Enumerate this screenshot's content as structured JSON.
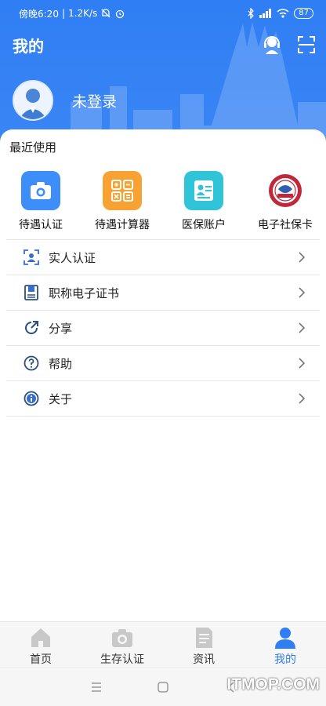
{
  "status_bar": {
    "time": "傍晚6:20",
    "network_speed": "1.2K/s",
    "battery": "87"
  },
  "header": {
    "title": "我的",
    "login_status": "未登录"
  },
  "recent": {
    "title": "最近使用",
    "items": [
      {
        "label": "待遇认证",
        "icon": "camera-icon",
        "color": "#3d8ef8"
      },
      {
        "label": "待遇计算器",
        "icon": "calculator-icon",
        "color": "#f7a233"
      },
      {
        "label": "医保账户",
        "icon": "id-card-icon",
        "color": "#2fc4d8"
      },
      {
        "label": "电子社保卡",
        "icon": "social-security-card-icon",
        "color": "#c0283a"
      }
    ]
  },
  "menu": {
    "items": [
      {
        "label": "实人认证",
        "icon": "face-scan-icon"
      },
      {
        "label": "职称电子证书",
        "icon": "certificate-icon"
      },
      {
        "label": "分享",
        "icon": "share-icon"
      },
      {
        "label": "帮助",
        "icon": "help-icon"
      },
      {
        "label": "关于",
        "icon": "info-icon"
      }
    ]
  },
  "tabbar": {
    "tabs": [
      {
        "label": "首页",
        "icon": "home-icon"
      },
      {
        "label": "生存认证",
        "icon": "camera-icon"
      },
      {
        "label": "资讯",
        "icon": "news-icon"
      },
      {
        "label": "我的",
        "icon": "user-icon"
      }
    ],
    "active_index": 3
  },
  "watermark": "ITMOP.COM",
  "colors": {
    "primary": "#2f7ef3",
    "tab_inactive": "#c8c8c8"
  }
}
